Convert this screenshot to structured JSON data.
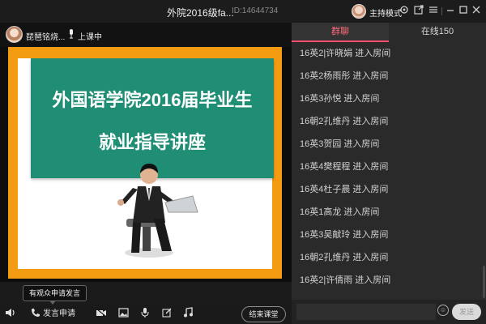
{
  "titlebar": {
    "title": "外院2016级fa...",
    "room_id": "ID:14644734",
    "host_mode": "主持模式",
    "icons": [
      "host-avatar",
      "settings-icon",
      "share-icon",
      "menu-icon",
      "minimize-icon",
      "maximize-icon",
      "close-icon"
    ]
  },
  "presenter": {
    "name": "琵琶铭烧...",
    "status": "上课中"
  },
  "slide": {
    "line1": "外国语学院2016届毕业生",
    "line2": "就业指导讲座"
  },
  "tooltip": "有观众申请发言",
  "toolbar": {
    "volume_icon": "🔊",
    "speak_request_label": "发言申请",
    "end_class_label": "结束课堂"
  },
  "chat_panel": {
    "tabs": [
      {
        "label": "群聊",
        "active": true
      },
      {
        "label": "在线150",
        "active": false
      }
    ],
    "messages": [
      "16英2|许晓娟 进入房间",
      "16英2杨雨彤 进入房间",
      "16英3孙悦 进入房间",
      "16朝2孔维丹 进入房间",
      "16英3贺园 进入房间",
      "16英4樊程程 进入房间",
      "16英4杜子晨 进入房间",
      "16英1高龙 进入房间",
      "16英3吴献玲 进入房间",
      "16朝2孔维丹 进入房间",
      "16英2|许倩雨 进入房间"
    ],
    "input_placeholder": "",
    "send_label": "发送"
  },
  "colors": {
    "accent_tab": "#ff4d6d",
    "slide_border": "#f39c12",
    "slide_banner": "#1f8e74"
  }
}
